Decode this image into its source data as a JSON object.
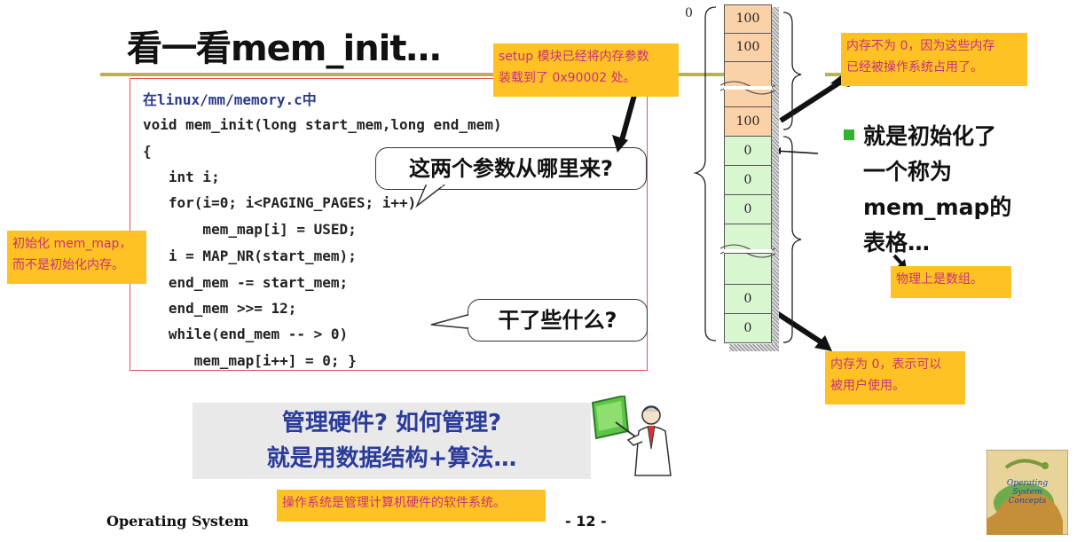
{
  "slide": {
    "title": "看一看mem_init…",
    "code_header": "在linux/mm/memory.c中",
    "code_lines": [
      "void mem_init(long start_mem,long end_mem)",
      "{",
      "   int i;",
      "   for(i=0; i<PAGING_PAGES; i++)",
      "       mem_map[i] = USED;",
      "   i = MAP_NR(start_mem);",
      "   end_mem -= start_mem;",
      "   end_mem >>= 12;",
      "   while(end_mem -- > 0)",
      "      mem_map[i++] = 0; }"
    ],
    "callout_params": "这两个参数从哪里来?",
    "callout_what": "干了些什么?",
    "management_line1": "管理硬件? 如何管理?",
    "management_line2": "就是用数据结构+算法…",
    "bullet_line1": "就是初始化了",
    "bullet_line2": "一个称为",
    "bullet_line3": "mem_map的",
    "bullet_line4": "表格…",
    "footer_left": "Operating System",
    "footer_page": "- 12 -"
  },
  "notes": {
    "setup_line1": "setup 模块已经将内存参数",
    "setup_line2": "装载到了 0x90002 处。",
    "init_line1": "初始化 mem_map，",
    "init_line2": "而不是初始化内存。",
    "occupied_line1": "内存不为 0，因为这些内存",
    "occupied_line2": "已经被操作系统占用了。",
    "physical": "物理上是数组。",
    "zero_line1": "内存为 0，表示可以",
    "zero_line2": "被用户使用。",
    "os_def": "操作系统是管理计算机硬件的软件系统。"
  },
  "mem_map": {
    "start_label": "0",
    "cells": [
      "100",
      "100",
      "",
      "100",
      "0",
      "0",
      "0",
      "",
      "",
      "0",
      "0"
    ]
  },
  "colors": {
    "used_cell": "#fbd1a8",
    "free_cell": "#d8f6d0",
    "note_bg": "#ffc224",
    "note_text": "#c8307a",
    "title_rule": "#b8b05a",
    "code_border": "#e0505a",
    "bullet": "#2db52d",
    "management_text": "#2b3b9a"
  },
  "icons": {
    "teacher": "teacher-pointing-at-board",
    "book_cover": "operating-system-concepts-cover"
  }
}
